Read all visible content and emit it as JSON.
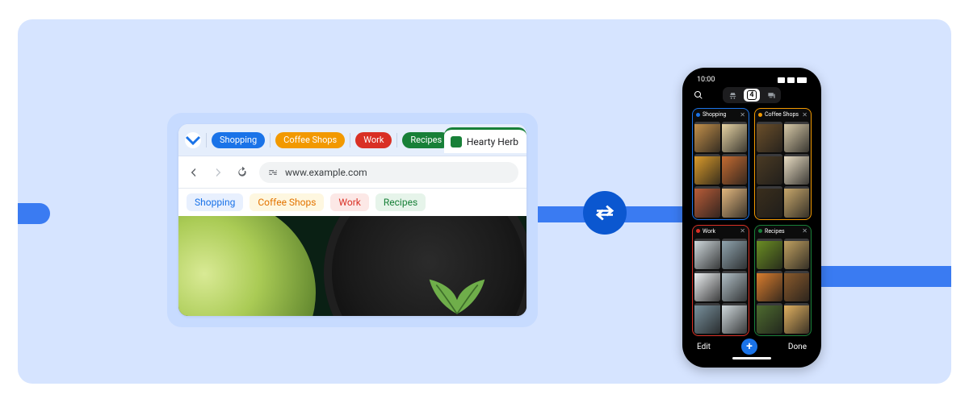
{
  "colors": {
    "shopping": "#1a73e8",
    "coffee": "#f29900",
    "work": "#d93025",
    "recipes": "#188038"
  },
  "desktop": {
    "groups": [
      {
        "key": "shopping",
        "label": "Shopping"
      },
      {
        "key": "coffee",
        "label": "Coffee Shops"
      },
      {
        "key": "work",
        "label": "Work"
      },
      {
        "key": "recipes",
        "label": "Recipes"
      }
    ],
    "active_tab": {
      "title": "Hearty Herb"
    },
    "url": "www.example.com",
    "chips": [
      {
        "key": "shopping",
        "label": "Shopping",
        "fg": "#1a73e8",
        "bg": "#e8f0fe"
      },
      {
        "key": "coffee",
        "label": "Coffee Shops",
        "fg": "#e37400",
        "bg": "#fef7e0"
      },
      {
        "key": "work",
        "label": "Work",
        "fg": "#d93025",
        "bg": "#fce8e6"
      },
      {
        "key": "recipes",
        "label": "Recipes",
        "fg": "#188038",
        "bg": "#e6f4ea"
      }
    ]
  },
  "phone": {
    "time": "10:00",
    "tab_count": "4",
    "edit_label": "Edit",
    "done_label": "Done",
    "groups": [
      {
        "key": "shopping",
        "label": "Shopping",
        "thumbs": 6
      },
      {
        "key": "coffee",
        "label": "Coffee Shops",
        "thumbs": 6
      },
      {
        "key": "work",
        "label": "Work",
        "thumbs": 6
      },
      {
        "key": "recipes",
        "label": "Recipes",
        "thumbs": 6
      }
    ]
  },
  "thumb_palettes": {
    "shopping": [
      "#c28f4a",
      "#e6d3a3",
      "#d99a2b",
      "#c46b32",
      "#b85c38",
      "#e2b77e"
    ],
    "coffee": [
      "#6b4f2a",
      "#d7c9a7",
      "#4a3a23",
      "#e8dcc2",
      "#3a2e1c",
      "#c7a76b"
    ],
    "work": [
      "#cfd8dc",
      "#90a4ae",
      "#eceff1",
      "#b0bec5",
      "#78909c",
      "#cfd8dc"
    ],
    "recipes": [
      "#6b8e23",
      "#c0a060",
      "#d97d2e",
      "#8a5a2c",
      "#4e6b2f",
      "#e0b060"
    ]
  }
}
